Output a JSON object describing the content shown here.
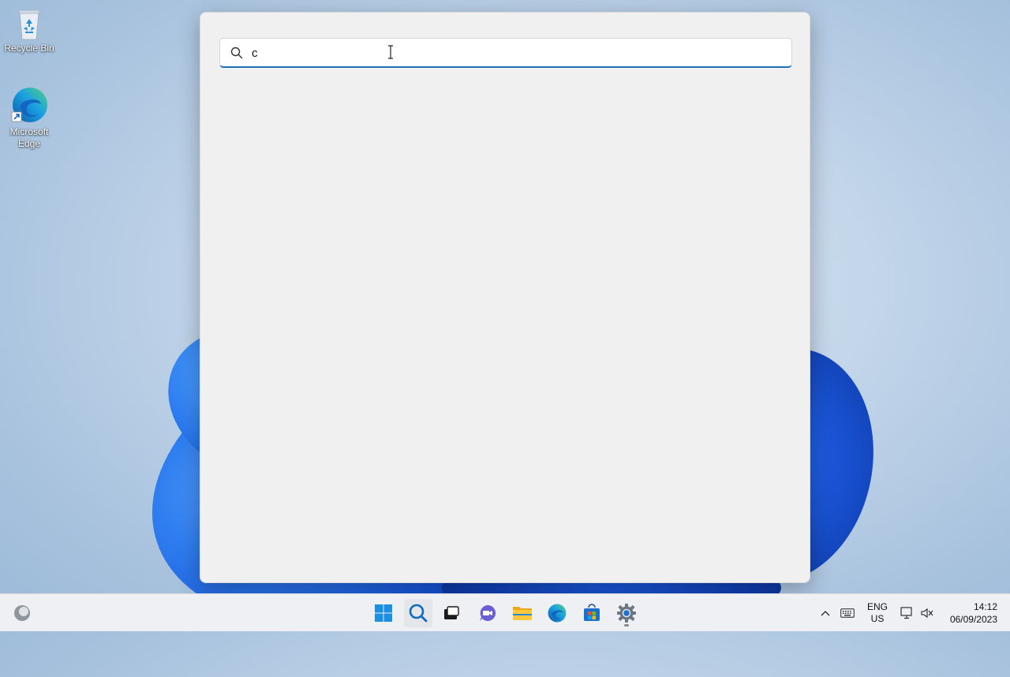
{
  "desktop": {
    "icons": [
      {
        "label": "Recycle Bin",
        "icon": "recycle-bin-icon"
      },
      {
        "label": "Microsoft Edge",
        "icon": "edge-icon"
      }
    ]
  },
  "search": {
    "value": "c",
    "placeholder": "",
    "icon": "search-icon"
  },
  "taskbar": {
    "apps": [
      {
        "name": "Start",
        "icon": "windows-start-icon"
      },
      {
        "name": "Search",
        "icon": "search-icon",
        "active": true
      },
      {
        "name": "Task View",
        "icon": "task-view-icon"
      },
      {
        "name": "Chat",
        "icon": "chat-icon"
      },
      {
        "name": "File Explorer",
        "icon": "folder-icon"
      },
      {
        "name": "Microsoft Edge",
        "icon": "edge-icon"
      },
      {
        "name": "Microsoft Store",
        "icon": "store-icon"
      },
      {
        "name": "Settings",
        "icon": "gear-icon",
        "running": true
      }
    ],
    "tray": {
      "language_line1": "ENG",
      "language_line2": "US",
      "time": "14:12",
      "date": "06/09/2023"
    }
  },
  "colors": {
    "accent": "#1f6fb5",
    "panel_bg": "#f0f0f0",
    "taskbar_bg": "#eef0f4"
  }
}
